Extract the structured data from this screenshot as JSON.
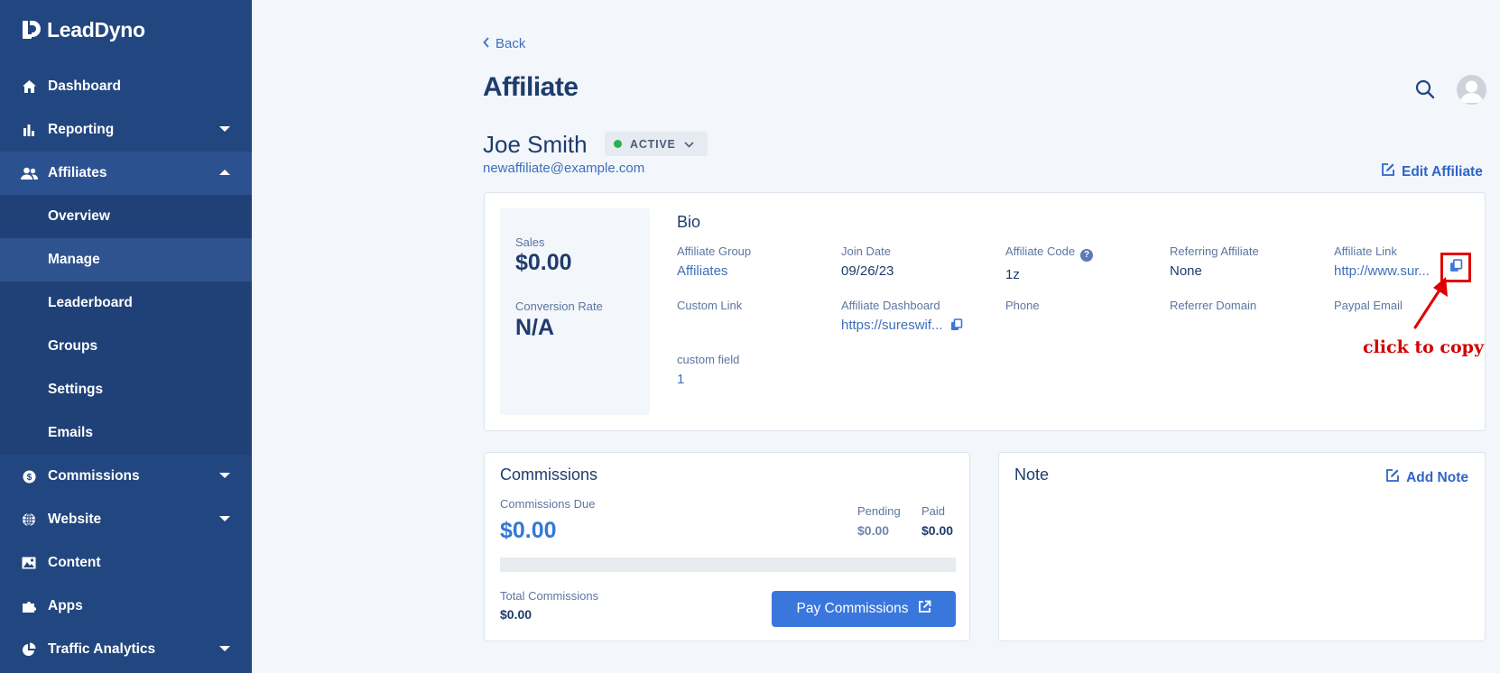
{
  "app": {
    "brand": "LeadDyno"
  },
  "colors": {
    "sidebar": "#22467f",
    "accent": "#3a77dd",
    "active_status": "#2ab24b",
    "annotation": "#d20000"
  },
  "sidebar": {
    "items": [
      {
        "label": "Dashboard",
        "icon": "home-icon"
      },
      {
        "label": "Reporting",
        "icon": "bar-chart-icon"
      },
      {
        "label": "Affiliates",
        "icon": "users-icon"
      },
      {
        "label": "Commissions",
        "icon": "dollar-circle-icon"
      },
      {
        "label": "Website",
        "icon": "globe-icon"
      },
      {
        "label": "Content",
        "icon": "image-icon"
      },
      {
        "label": "Apps",
        "icon": "puzzle-icon"
      },
      {
        "label": "Traffic Analytics",
        "icon": "pie-chart-icon"
      }
    ],
    "affiliates_sub": [
      "Overview",
      "Manage",
      "Leaderboard",
      "Groups",
      "Settings",
      "Emails"
    ]
  },
  "header": {
    "back": "Back",
    "title": "Affiliate"
  },
  "affiliate": {
    "name": "Joe Smith",
    "status": "ACTIVE",
    "email": "newaffiliate@example.com",
    "edit_label": "Edit Affiliate"
  },
  "stats": {
    "sales_label": "Sales",
    "sales_value": "$0.00",
    "conversion_label": "Conversion Rate",
    "conversion_value": "N/A"
  },
  "bio": {
    "title": "Bio",
    "affiliate_group_label": "Affiliate Group",
    "affiliate_group": "Affiliates",
    "join_date_label": "Join Date",
    "join_date": "09/26/23",
    "affiliate_code_label": "Affiliate Code",
    "affiliate_code": "1z",
    "referring_affiliate_label": "Referring Affiliate",
    "referring_affiliate": "None",
    "affiliate_link_label": "Affiliate Link",
    "affiliate_link": "http://www.sur...",
    "custom_link_label": "Custom Link",
    "affiliate_dashboard_label": "Affiliate Dashboard",
    "affiliate_dashboard": "https://sureswif...",
    "phone_label": "Phone",
    "referrer_domain_label": "Referrer Domain",
    "paypal_email_label": "Paypal Email",
    "custom_field_label": "custom field",
    "custom_field": "1"
  },
  "annotation": {
    "text": "click to copy"
  },
  "commissions": {
    "title": "Commissions",
    "due_label": "Commissions Due",
    "due_value": "$0.00",
    "pending_label": "Pending",
    "pending_value": "$0.00",
    "paid_label": "Paid",
    "paid_value": "$0.00",
    "progress_fraction": 0,
    "total_label": "Total Commissions",
    "total_value": "$0.00",
    "pay_button": "Pay Commissions"
  },
  "note": {
    "title": "Note",
    "add_label": "Add Note"
  }
}
